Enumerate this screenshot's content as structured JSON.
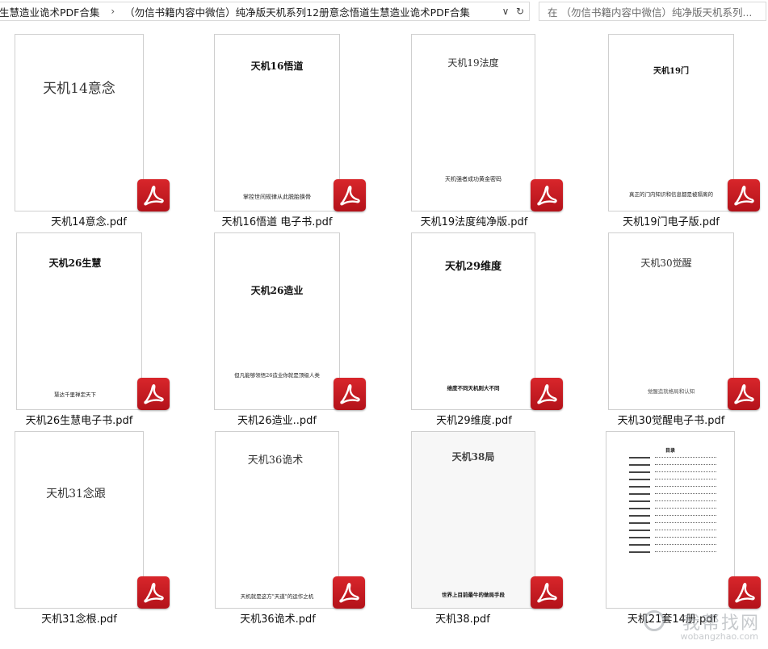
{
  "address_bar": {
    "breadcrumb_prev": "生慧造业诡术PDF合集",
    "breadcrumb_current": "（勿信书籍内容中微信）纯净版天机系列12册意念悟道生慧造业诡术PDF合集",
    "dropdown_glyph": "∨",
    "refresh_glyph": "↻"
  },
  "search": {
    "placeholder": "在 （勿信书籍内容中微信）纯净版天机系列..."
  },
  "files": [
    {
      "filename": "天机14意念.pdf",
      "cover_title": "天机14意念",
      "cover_subtitle": ""
    },
    {
      "filename": "天机16悟道 电子书.pdf",
      "cover_title": "天机16悟道",
      "cover_subtitle": "掌控世间规律从此脱胎换骨"
    },
    {
      "filename": "天机19法度纯净版.pdf",
      "cover_title": "天机19法度",
      "cover_subtitle": "天机强者成功黄金密码"
    },
    {
      "filename": "天机19门电子版.pdf",
      "cover_title": "天机19门",
      "cover_subtitle": "真正的门内知识和信息都是被隔离的"
    },
    {
      "filename": "天机26生慧电子书.pdf",
      "cover_title": "天机26生慧",
      "cover_subtitle": "慧达千里禅定天下"
    },
    {
      "filename": "天机26造业..pdf",
      "cover_title": "天机26造业",
      "cover_subtitle": "但凡能够领悟26造业你就是顶级人类"
    },
    {
      "filename": "天机29维度.pdf",
      "cover_title": "天机29维度",
      "cover_subtitle": "维度不同天机则大不同"
    },
    {
      "filename": "天机30觉醒电子书.pdf",
      "cover_title": "天机30觉醒",
      "cover_subtitle": "觉醒造就格局和认知"
    },
    {
      "filename": "天机31念根.pdf",
      "cover_title": "天机31念跟",
      "cover_subtitle": ""
    },
    {
      "filename": "天机36诡术.pdf",
      "cover_title": "天机36诡术",
      "cover_subtitle": "天机就是这方\"天道\"的运作之机"
    },
    {
      "filename": "天机38.pdf",
      "cover_title": "天机38局",
      "cover_subtitle": "世界上目前最牛的做局手段"
    },
    {
      "filename": "天机21套14册.pdf",
      "cover_title": "目录",
      "cover_subtitle": ""
    }
  ],
  "icons": {
    "pdf_badge": "acrobat-pdf-icon",
    "badge_color": "#c8191f"
  },
  "watermark": {
    "main": "我帮找网",
    "sub": "wobangzhao.com"
  }
}
